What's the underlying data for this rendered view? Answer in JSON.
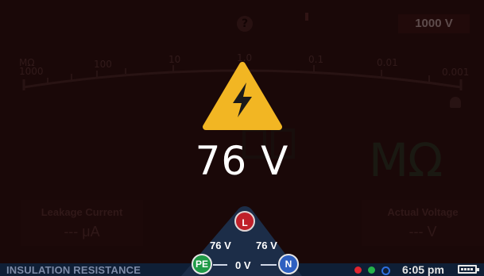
{
  "header": {
    "range_label": "1000 V",
    "help_icon": "help-icon"
  },
  "scale": {
    "ticks": [
      "MΩ\n1000",
      "100",
      "10",
      "1.0",
      "0.1",
      "0.01",
      "0.001"
    ],
    "unit_top": "MΩ",
    "tick_1000": "1000",
    "tick_100": "100",
    "tick_10": "10",
    "tick_1": "1.0",
    "tick_01": "0.1",
    "tick_001": "0.01",
    "tick_0001": "0.001"
  },
  "background_reading": {
    "unit": "MΩ"
  },
  "warning": {
    "icon": "high-voltage-warning-icon",
    "voltage_value": "76 V"
  },
  "panels": {
    "leakage": {
      "title": "Leakage Current",
      "value": "--- μA"
    },
    "actual_voltage": {
      "title": "Actual Voltage",
      "value": "--- V"
    }
  },
  "diagram": {
    "node_l": "L",
    "node_pe": "PE",
    "node_n": "N",
    "l_pe": "76 V",
    "l_n": "76 V",
    "pe_n": "0 V"
  },
  "status_bar": {
    "mode": "INSULATION RESISTANCE",
    "time": "6:05 pm",
    "dots": [
      "#e0242e",
      "#25b34a",
      "#2d6fe0"
    ]
  }
}
